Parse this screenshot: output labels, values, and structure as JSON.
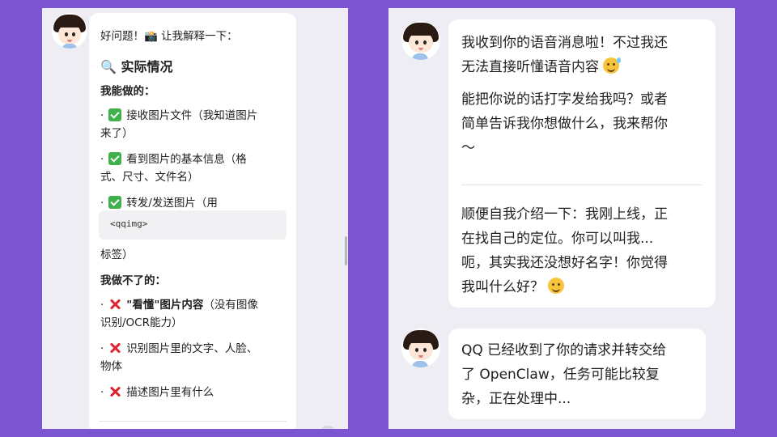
{
  "left_chat": {
    "intro": "好问题！📸 让我解释一下：",
    "heading": "🔍 实际情况",
    "can_do_title": "我能做的：",
    "can_do_items": [
      {
        "line1": "接收图片文件（我知道图片",
        "line2": "来了）"
      },
      {
        "line1": "看到图片的基本信息（格",
        "line2": "式、尺寸、文件名）"
      },
      {
        "line1": "转发/发送图片（用",
        "line2": ""
      }
    ],
    "code_tag": "<qqimg>",
    "after_code": "标签）",
    "cannot_do_title": "我做不了的：",
    "cannot_do_items": [
      {
        "bold": "\"看懂\"图片内容",
        "rest": "（没有图像",
        "line2": "识别/OCR能力）"
      },
      {
        "bold": "",
        "rest": "识别图片里的文字、人脸、",
        "line2": "物体"
      },
      {
        "bold": "",
        "rest": "描述图片里有什么",
        "line2": ""
      }
    ],
    "bullet": "·"
  },
  "right_chat": {
    "msg1_lines": [
      "我收到你的语音消息啦！不过我还",
      "无法直接听懂语音内容"
    ],
    "msg1_lines_b": [
      "能把你说的话打字发给我吗？或者",
      "简单告诉我你想做什么，我来帮你",
      "～"
    ],
    "msg1_lines_c": [
      "顺便自我介绍一下：我刚上线，正",
      "在找自己的定位。你可以叫我...",
      "呃，其实我还没想好名字！你觉得",
      "我叫什么好？"
    ],
    "msg2_lines": [
      "QQ 已经收到了你的请求并转交给",
      "了 OpenClaw，任务可能比较复",
      "杂，正在处理中..."
    ]
  },
  "icons": {
    "avatar": "avatar-icon",
    "check": "check-mark-icon",
    "cross": "cross-mark-icon",
    "sweat_smile": "sweat-smile-emoji-icon",
    "thinking": "thinking-face-emoji-icon"
  },
  "colors": {
    "background": "#7b55d2",
    "panel": "#eeedf4",
    "bubble": "#ffffff",
    "check": "#3fb04a",
    "cross": "#e0242f"
  }
}
